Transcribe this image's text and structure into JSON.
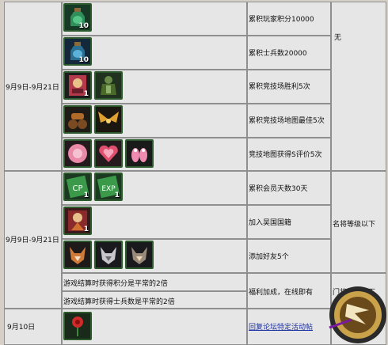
{
  "dates": {
    "section1": "9月9日-9月21日",
    "section2": "9月9日-9月21日",
    "section3": "9月10日"
  },
  "rows": [
    {
      "condition": "累积玩家积分10000",
      "icons": [
        {
          "name": "green-potion-icon",
          "count": "10"
        }
      ]
    },
    {
      "condition": "累积士兵数20000",
      "icons": [
        {
          "name": "blue-potion-icon",
          "count": "10"
        }
      ]
    },
    {
      "condition": "累积竞技场胜利5次",
      "icons": [
        {
          "name": "card-icon",
          "count": "1"
        },
        {
          "name": "soldier-icon",
          "count": ""
        }
      ]
    },
    {
      "condition": "累积竞技场地图最佳5次",
      "icons": [
        {
          "name": "cannon-icon",
          "count": ""
        },
        {
          "name": "wings-icon",
          "count": ""
        }
      ]
    },
    {
      "condition": "竞技地图获得S评价5次",
      "icons": [
        {
          "name": "pink-cushion-icon",
          "count": ""
        },
        {
          "name": "heart-icon",
          "count": ""
        },
        {
          "name": "pink-slippers-icon",
          "count": ""
        }
      ]
    },
    {
      "condition": "累积会员天数30天",
      "icons": [
        {
          "name": "cp-card-icon",
          "count": "1"
        },
        {
          "name": "exp-card-icon",
          "count": "1"
        }
      ]
    },
    {
      "condition": "加入吴国国籍",
      "icons": [
        {
          "name": "character-card-icon",
          "count": "1"
        }
      ]
    },
    {
      "condition": "添加好友5个",
      "icons": [
        {
          "name": "fox-mask-icon",
          "count": ""
        },
        {
          "name": "wolf-mask-icon",
          "count": ""
        },
        {
          "name": "fox-helmet-icon",
          "count": ""
        }
      ]
    }
  ],
  "bonus_rows": [
    "游戏结算时获得积分是平常的2倍",
    "游戏结算时获得士兵数是平常的2倍"
  ],
  "bonus_condition": "福利加成，在线即有",
  "last_row": {
    "icon": {
      "name": "rose-icon",
      "count": ""
    },
    "link": "回复论坛特定活动帖"
  },
  "requirements": {
    "section1": "无",
    "section2": "名将等级以下",
    "section3": "门将等级以下"
  },
  "colors": {
    "cell": "#e6e6e6",
    "border": "#8f8f8f",
    "link": "#1a2fa3"
  }
}
